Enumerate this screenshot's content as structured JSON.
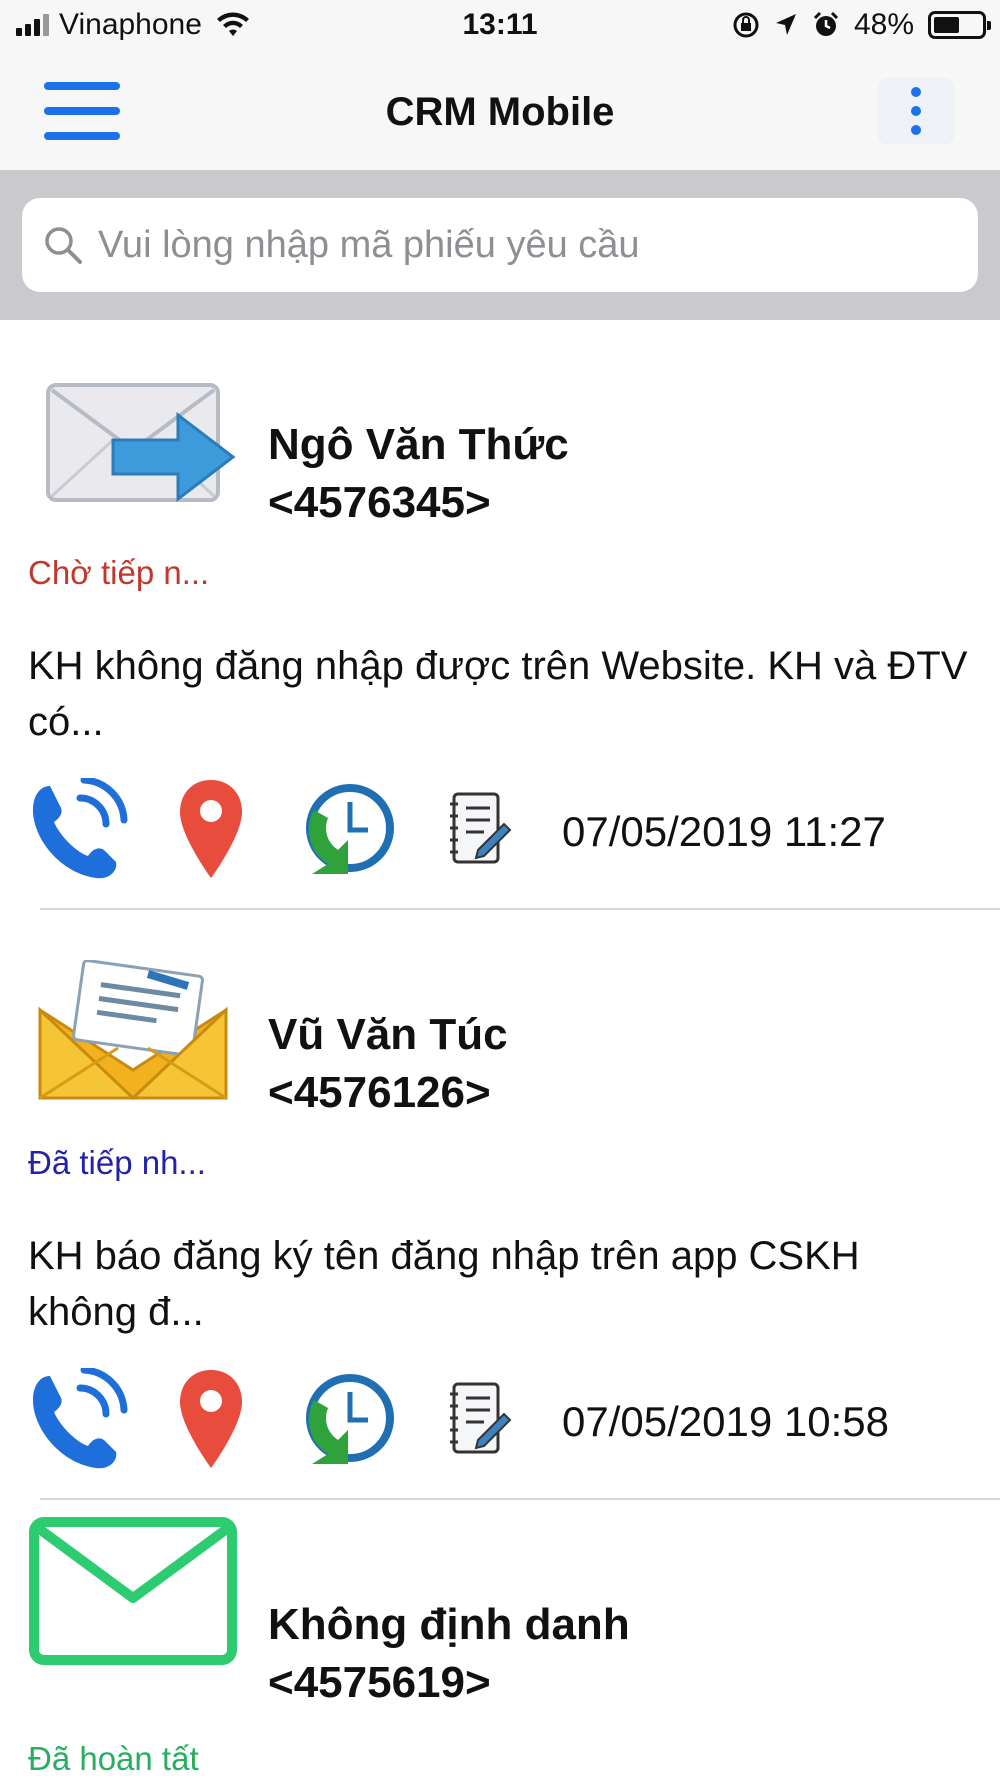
{
  "status_bar": {
    "carrier": "Vinaphone",
    "time": "13:11",
    "battery": "48%"
  },
  "nav": {
    "title": "CRM Mobile"
  },
  "search": {
    "placeholder": "Vui lòng nhập mã phiếu yêu cầu",
    "value": ""
  },
  "tickets": [
    {
      "name": "Ngô Văn Thức",
      "code": "<4576345>",
      "status": "Chờ tiếp n...",
      "status_color": "#c0392b",
      "description": "KH không đăng nhập được trên Website. KH và ĐTV có...",
      "datetime": "07/05/2019 11:27",
      "icon": "mail-forward-icon"
    },
    {
      "name": "Vũ Văn Túc",
      "code": "<4576126>",
      "status": "Đã tiếp nh...",
      "status_color": "#2222aa",
      "description": "KH báo đăng ký tên đăng nhập trên app CSKH không đ...",
      "datetime": "07/05/2019 10:58",
      "icon": "open-envelope-icon"
    },
    {
      "name": "Không định danh",
      "code": "<4575619>",
      "status": "Đã hoàn tất",
      "status_color": "#27ae60",
      "icon": "green-envelope-icon"
    }
  ],
  "colors": {
    "accent": "#1a73e8",
    "nav_bg": "#f7f7f7",
    "search_bg": "#c9c9ce"
  }
}
